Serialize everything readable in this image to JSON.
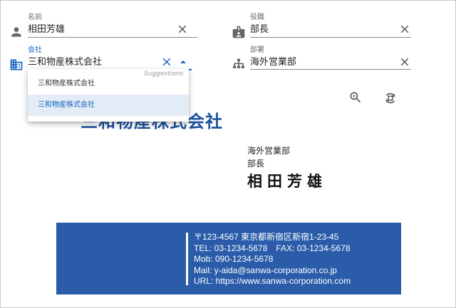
{
  "form": {
    "name": {
      "label": "名前",
      "value": "相田芳雄",
      "icon": "person-icon"
    },
    "position": {
      "label": "役職",
      "value": "部長",
      "icon": "badge-icon"
    },
    "company": {
      "label": "会社",
      "value": "三和物産株式会社",
      "icon": "building-icon"
    },
    "department": {
      "label": "部署",
      "value": "海外営業部",
      "icon": "org-chart-icon"
    }
  },
  "suggestions": {
    "hint": "Suggestions",
    "options": [
      "三和物産株式会社",
      "三和物産株式会社"
    ],
    "selected_index": 1
  },
  "toolbar": {
    "zoom_icon": "zoom-in-icon",
    "rotate_icon": "rotate-icon"
  },
  "card": {
    "company": "三和物産株式会社",
    "department": "海外営業部",
    "position": "部長",
    "name": "相田芳雄",
    "contact": {
      "address": "〒123-4567 東京都新宿区新宿1-23-45",
      "tel_fax": "TEL: 03-1234-5678　FAX: 03-1234-5678",
      "mobile": "Mob: 090-1234-5678",
      "mail": "Mail: y-aida@sanwa-corporation.co.jp",
      "url": "URL: https://www.sanwa-corporation.com"
    },
    "footer_color": "#2a5caa",
    "accent_color": "#1565c0"
  }
}
